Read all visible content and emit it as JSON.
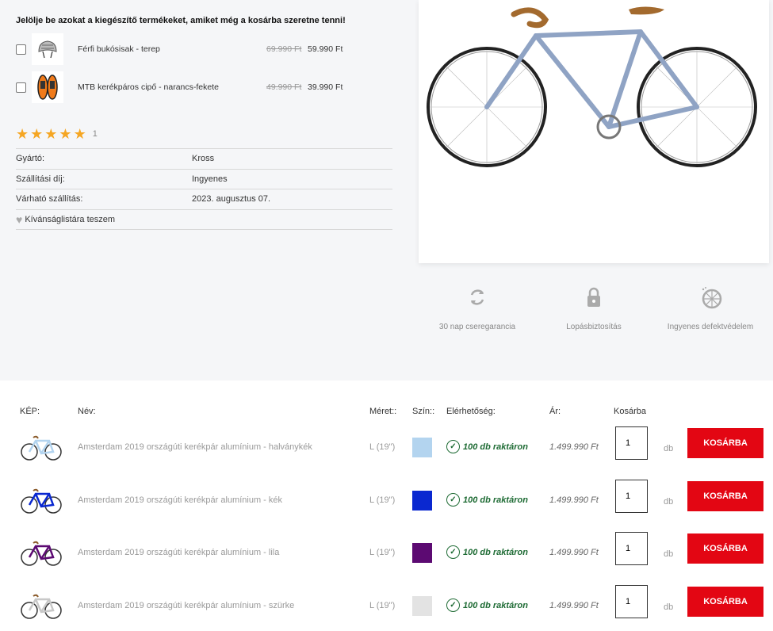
{
  "addons": {
    "title": "Jelölje be azokat a kiegészítő termékeket, amiket még a kosárba szeretne tenni!",
    "items": [
      {
        "name": "Férfi bukósisak - terep",
        "old_price": "69.990 Ft",
        "price": "59.990 Ft"
      },
      {
        "name": "MTB kerékpáros cipő - narancs-fekete",
        "old_price": "49.990 Ft",
        "price": "39.990 Ft"
      }
    ]
  },
  "rating": {
    "stars": 5,
    "max": 5,
    "count": "1"
  },
  "info": [
    {
      "key": "Gyártó:",
      "value": "Kross"
    },
    {
      "key": "Szállítási díj:",
      "value": "Ingyenes"
    },
    {
      "key": "Várható szállítás:",
      "value": "2023. augusztus 07."
    }
  ],
  "wishlist_label": "Kívánságlistára teszem",
  "features": [
    {
      "label": "30 nap cseregarancia",
      "icon": "exchange-icon"
    },
    {
      "label": "Lopásbiztosítás",
      "icon": "lock-icon"
    },
    {
      "label": "Ingyenes defektvédelem",
      "icon": "wheel-icon"
    }
  ],
  "table": {
    "headers": {
      "image": "KÉP:",
      "name": "Név:",
      "size": "Méret::",
      "color": "Szín::",
      "availability": "Elérhetőség:",
      "price": "Ár:",
      "cart": "Kosárba"
    },
    "unit": "db",
    "button_label": "KOSÁRBA",
    "rows": [
      {
        "name": "Amsterdam 2019 országúti kerékpár alumínium - halványkék",
        "size": "L (19\")",
        "color": "#b3d4ef",
        "stock": "100 db raktáron",
        "price": "1.499.990 Ft",
        "qty": "1"
      },
      {
        "name": "Amsterdam 2019 országúti kerékpár alumínium - kék",
        "size": "L (19\")",
        "color": "#0a28d0",
        "stock": "100 db raktáron",
        "price": "1.499.990 Ft",
        "qty": "1"
      },
      {
        "name": "Amsterdam 2019 országúti kerékpár alumínium - lila",
        "size": "L (19\")",
        "color": "#5c0a72",
        "stock": "100 db raktáron",
        "price": "1.499.990 Ft",
        "qty": "1"
      },
      {
        "name": "Amsterdam 2019 országúti kerékpár alumínium - szürke",
        "size": "L (19\")",
        "color": "#e3e3e3",
        "stock": "100 db raktáron",
        "price": "1.499.990 Ft",
        "qty": "1"
      }
    ]
  }
}
